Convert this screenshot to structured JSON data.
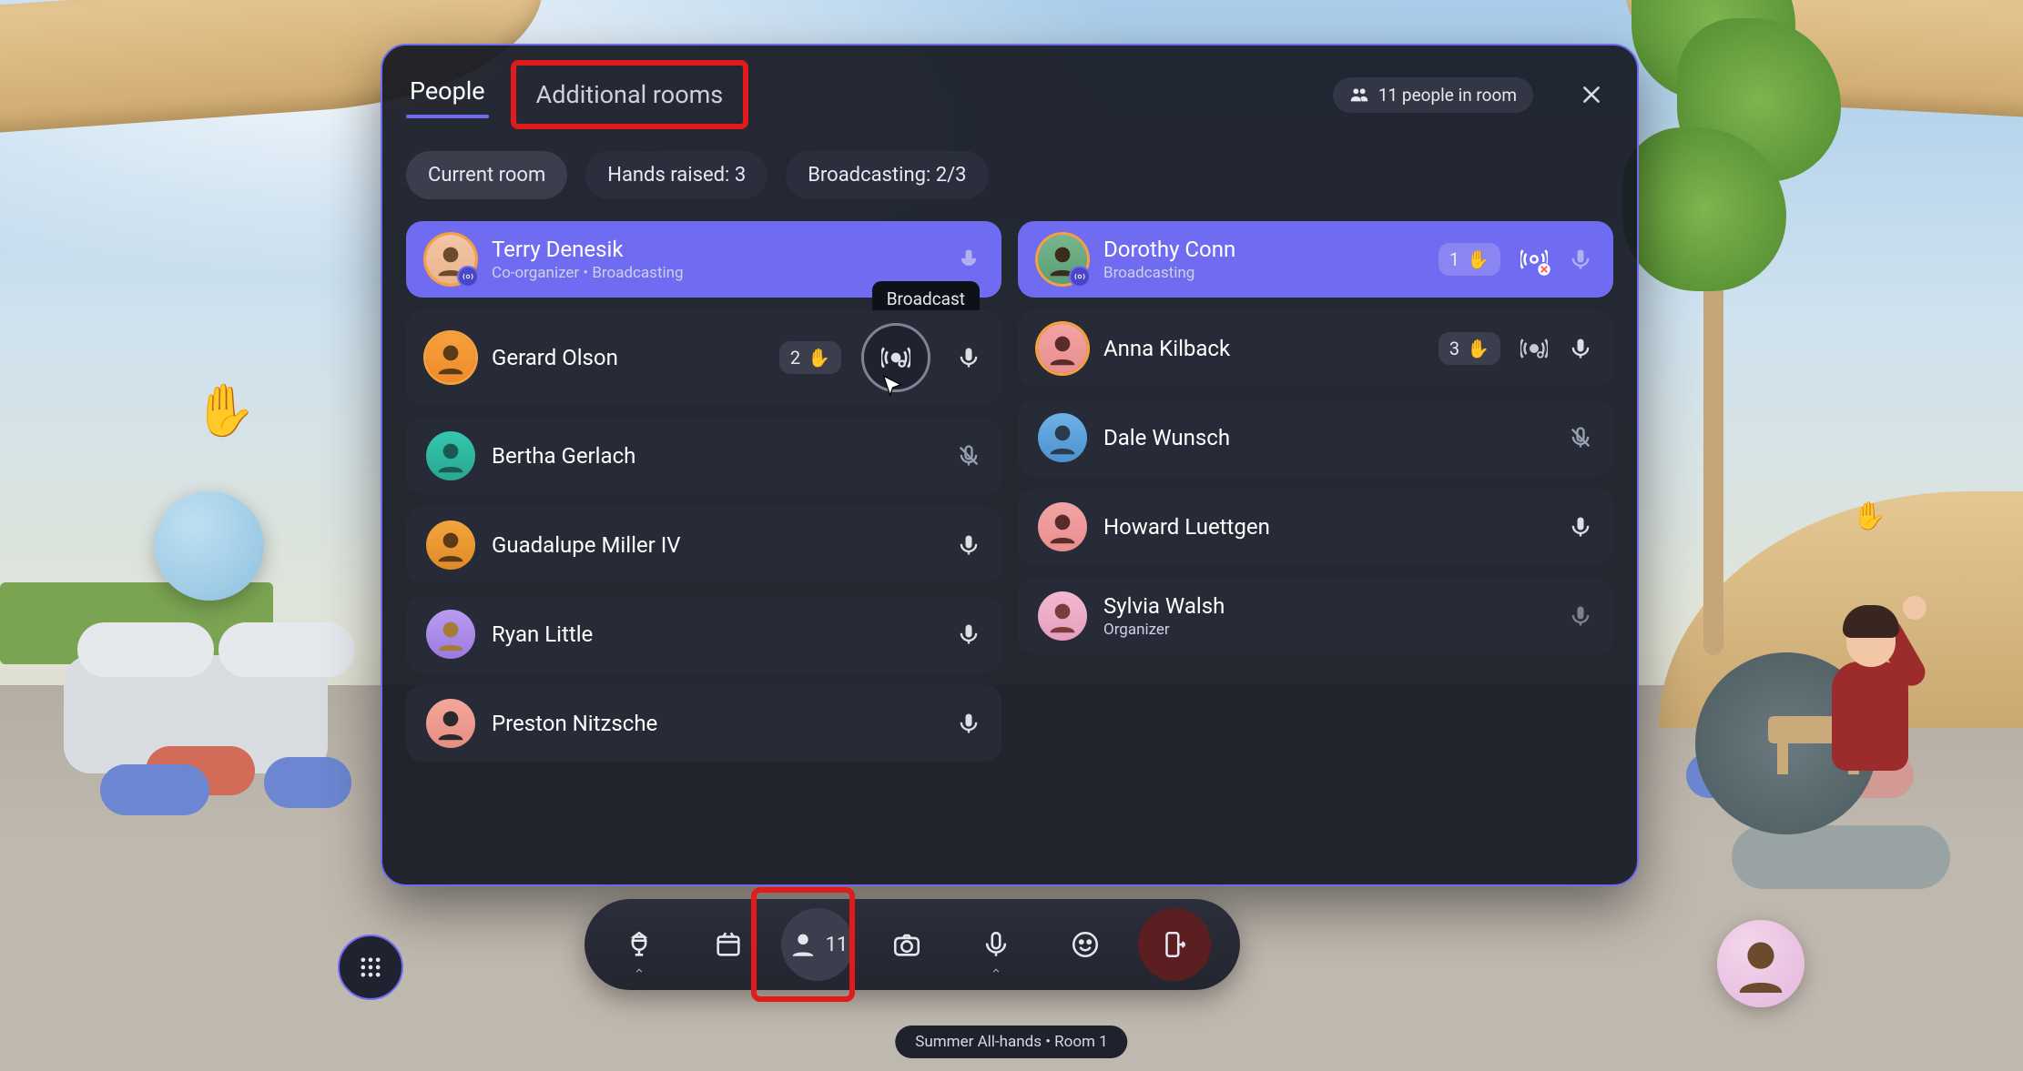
{
  "tabs": {
    "people": "People",
    "additional_rooms": "Additional rooms"
  },
  "count_badge": "11 people in room",
  "filters": {
    "current_room": "Current room",
    "hands_raised": "Hands raised: 3",
    "broadcasting": "Broadcasting: 2/3"
  },
  "tooltip_broadcast": "Broadcast",
  "left": [
    {
      "name": "Terry Denesik",
      "sub": "Co-organizer • Broadcasting"
    },
    {
      "name": "Gerard Olson",
      "hand": "2"
    },
    {
      "name": "Bertha Gerlach"
    },
    {
      "name": "Guadalupe Miller IV"
    },
    {
      "name": "Ryan Little"
    },
    {
      "name": "Preston Nitzsche"
    }
  ],
  "right": [
    {
      "name": "Dorothy Conn",
      "sub": "Broadcasting",
      "hand": "1"
    },
    {
      "name": "Anna Kilback",
      "hand": "3"
    },
    {
      "name": "Dale Wunsch"
    },
    {
      "name": "Howard Luettgen"
    },
    {
      "name": "Sylvia Walsh",
      "sub": "Organizer"
    }
  ],
  "toolbar": {
    "people_count": "11"
  },
  "room_tag": "Summer All-hands • Room 1"
}
